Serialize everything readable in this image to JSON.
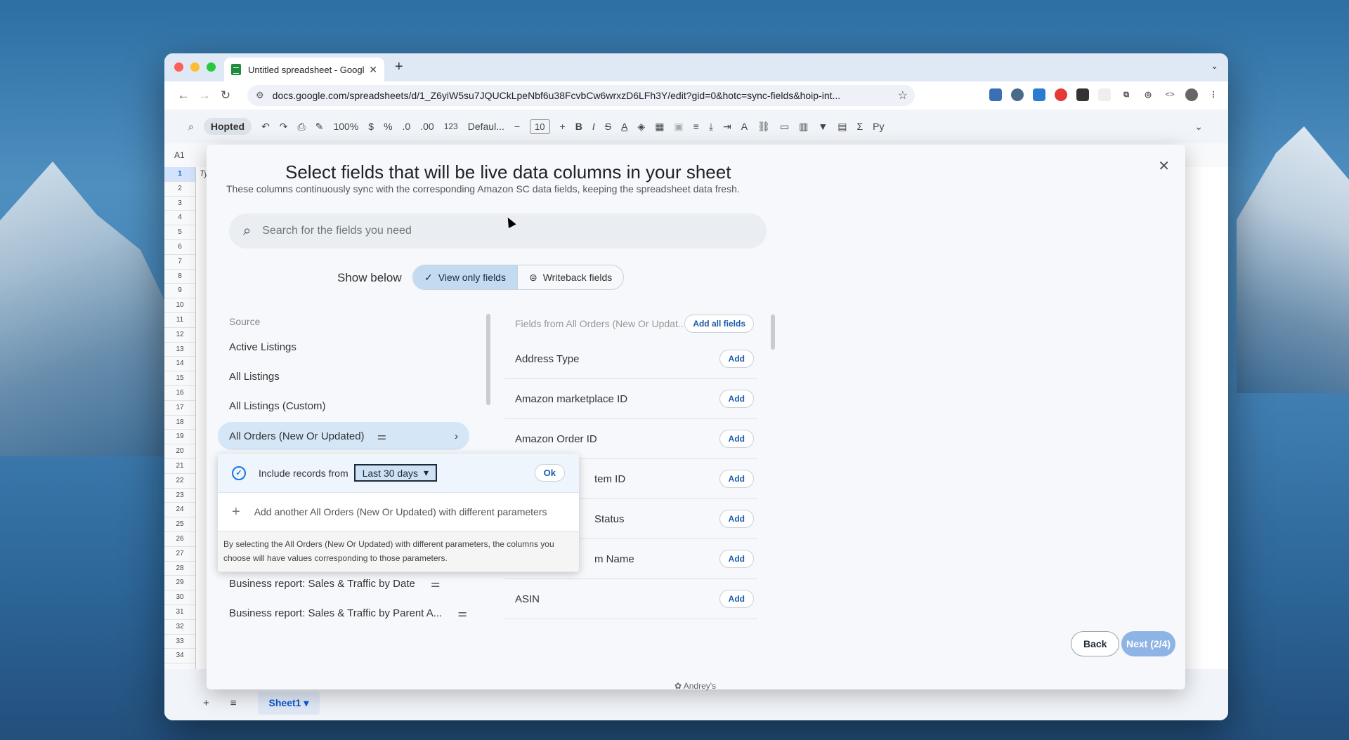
{
  "browser": {
    "tab_title": "Untitled spreadsheet - Googl",
    "url": "docs.google.com/spreadsheets/d/1_Z6yiW5su7JQUCkLpeNbf6u38FcvbCw6wrxzD6LFh3Y/edit?gid=0&hotc=sync-fields&hoip-int..."
  },
  "sheets_toolbar": {
    "hopted_label": "Hopted",
    "zoom": "100%",
    "currency": "$",
    "percent": "%",
    "dec_decrease": ".0",
    "dec_increase": ".00",
    "number_format": "123",
    "font": "Defaul...",
    "font_size": "10",
    "cell_ref": "A1"
  },
  "grid": {
    "cell_a1_text": "Ty",
    "rows": [
      "1",
      "2",
      "3",
      "4",
      "5",
      "6",
      "7",
      "8",
      "9",
      "10",
      "11",
      "12",
      "13",
      "14",
      "15",
      "16",
      "17",
      "18",
      "19",
      "20",
      "21",
      "22",
      "23",
      "24",
      "25",
      "26",
      "27",
      "28",
      "29",
      "30",
      "31",
      "32",
      "33",
      "34"
    ]
  },
  "bottom": {
    "sheet_tab": "Sheet1"
  },
  "dialog": {
    "title": "Select fields that will be live data columns in your sheet",
    "subtitle": "These columns continuously sync with the corresponding Amazon SC data fields, keeping the spreadsheet data fresh.",
    "search_placeholder": "Search for the fields you need",
    "show_below_label": "Show below",
    "view_only_label": "View only fields",
    "writeback_label": "Writeback fields",
    "source_label": "Source",
    "sources": [
      "Active Listings",
      "All Listings",
      "All Listings (Custom)",
      "All Orders (New Or Updated)",
      "Business report: Sales & Traffic by Date",
      "Business report: Sales & Traffic by Parent A..."
    ],
    "fields_header": "Fields from All Orders (New Or Updat...",
    "add_all_label": "Add all fields",
    "add_label": "Add",
    "fields": [
      "Address Type",
      "Amazon marketplace ID",
      "Amazon Order ID",
      "tem ID",
      "Status",
      "m Name",
      "ASIN"
    ],
    "back_label": "Back",
    "next_label": "Next (2/4)",
    "footer_tag": "Andrey's",
    "popover": {
      "include_label": "Include records from",
      "range_value": "Last 30 days",
      "ok_label": "Ok",
      "add_another": "Add another All Orders (New Or Updated) with different parameters",
      "note": "By selecting the All Orders (New Or Updated) with different parameters, the columns you choose will have values corresponding to those parameters."
    }
  }
}
